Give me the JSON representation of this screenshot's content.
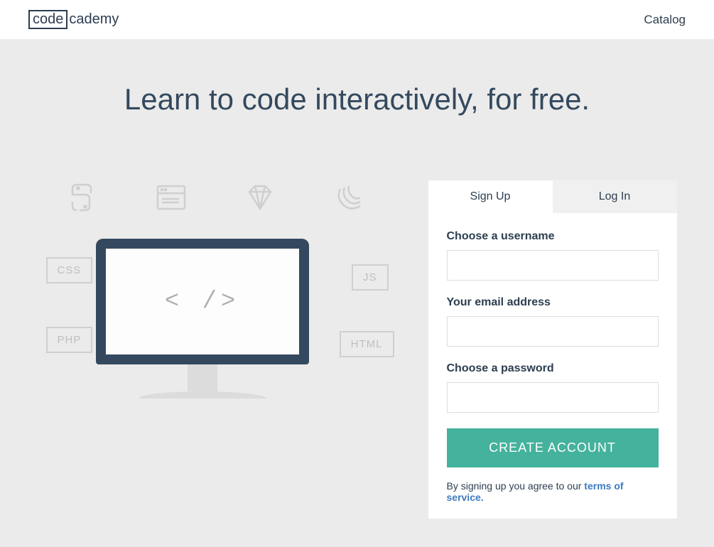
{
  "header": {
    "logo_boxed": "code",
    "logo_rest": "cademy",
    "nav_catalog": "Catalog"
  },
  "hero": {
    "title": "Learn to code interactively, for free."
  },
  "illustration": {
    "tags": {
      "css": "CSS",
      "js": "JS",
      "php": "PHP",
      "html": "HTML"
    },
    "screen_text": "< />"
  },
  "signup": {
    "tabs": {
      "signup": "Sign Up",
      "login": "Log In"
    },
    "username_label": "Choose a username",
    "email_label": "Your email address",
    "password_label": "Choose a password",
    "submit_label": "CREATE ACCOUNT",
    "terms_prefix": "By signing up you agree to our ",
    "terms_link": "terms of service."
  }
}
